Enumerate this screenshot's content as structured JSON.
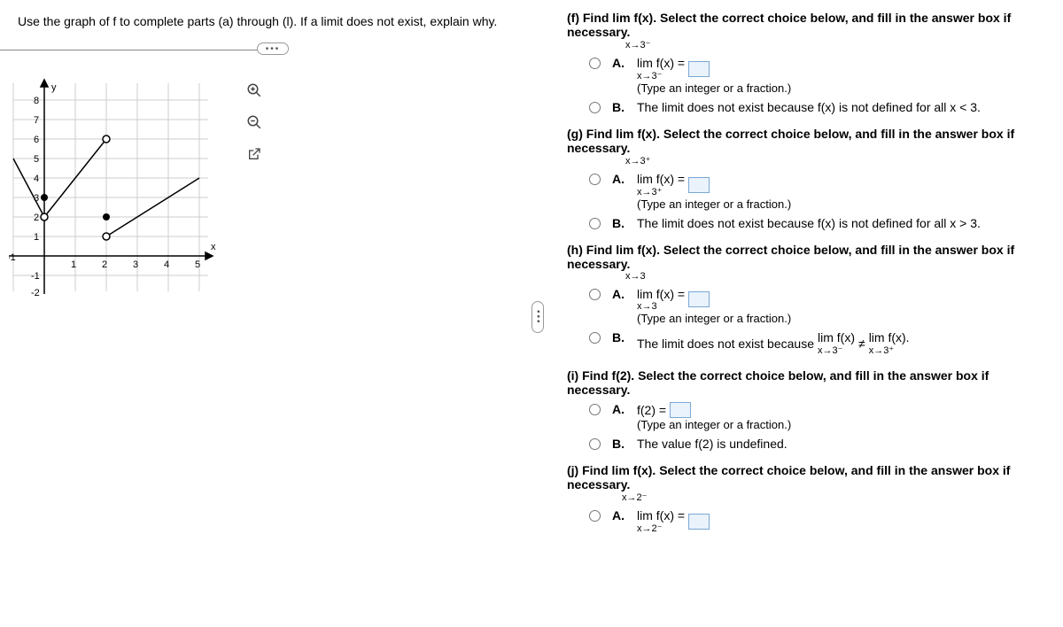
{
  "instruction": "Use the graph of f to complete parts (a) through (l). If a limit does not exist, explain why.",
  "hint_text": "(Type an integer or a fraction.)",
  "chart_data": {
    "type": "line",
    "xlabel": "x",
    "ylabel": "y",
    "xlim": [
      -1,
      5
    ],
    "ylim": [
      -2,
      8
    ],
    "grid": true,
    "segments": [
      {
        "from": [
          -1,
          5
        ],
        "to": [
          0,
          2
        ],
        "open_end": true
      },
      {
        "from": [
          0,
          2
        ],
        "to": [
          2,
          6
        ],
        "open_start": true,
        "open_end": true
      },
      {
        "from": [
          2,
          1
        ],
        "to": [
          5,
          4
        ],
        "open_start": true
      }
    ],
    "points": [
      {
        "x": 0,
        "y": 3,
        "type": "closed"
      },
      {
        "x": 2,
        "y": 2,
        "type": "closed"
      }
    ]
  },
  "q_f": {
    "prompt": "(f) Find  lim  f(x). Select the correct choice below, and fill in the answer box if necessary.",
    "sub": "x→3⁻",
    "A_lim": "lim  f(x) =",
    "A_sub": "x→3⁻",
    "B": "The limit does not exist because f(x) is not defined for all x < 3."
  },
  "q_g": {
    "prompt": "(g) Find  lim  f(x). Select the correct choice below, and fill in the answer box if necessary.",
    "sub": "x→3⁺",
    "A_lim": "lim  f(x) =",
    "A_sub": "x→3⁺",
    "B": "The limit does not exist because f(x) is not defined for all x > 3."
  },
  "q_h": {
    "prompt": "(h) Find  lim f(x). Select the correct choice below, and fill in the answer box if necessary.",
    "sub": "x→3",
    "A_lim": "lim f(x) =",
    "A_sub": "x→3",
    "B_pre": "The limit does not exist because ",
    "B_lim1": "lim  f(x)",
    "B_sub1": "x→3⁻",
    "B_ne": " ≠ ",
    "B_lim2": "lim  f(x).",
    "B_sub2": "x→3⁺"
  },
  "q_i": {
    "prompt": "(i) Find f(2). Select the correct choice below, and fill in the answer box if necessary.",
    "A": "f(2) =",
    "B": "The value f(2) is undefined."
  },
  "q_j": {
    "prompt": "(j) Find  lim  f(x). Select the correct choice below, and fill in the answer box if necessary.",
    "sub": "x→2⁻",
    "A_lim": "lim  f(x) =",
    "A_sub": "x→2⁻"
  },
  "labels": {
    "A": "A.",
    "B": "B."
  }
}
